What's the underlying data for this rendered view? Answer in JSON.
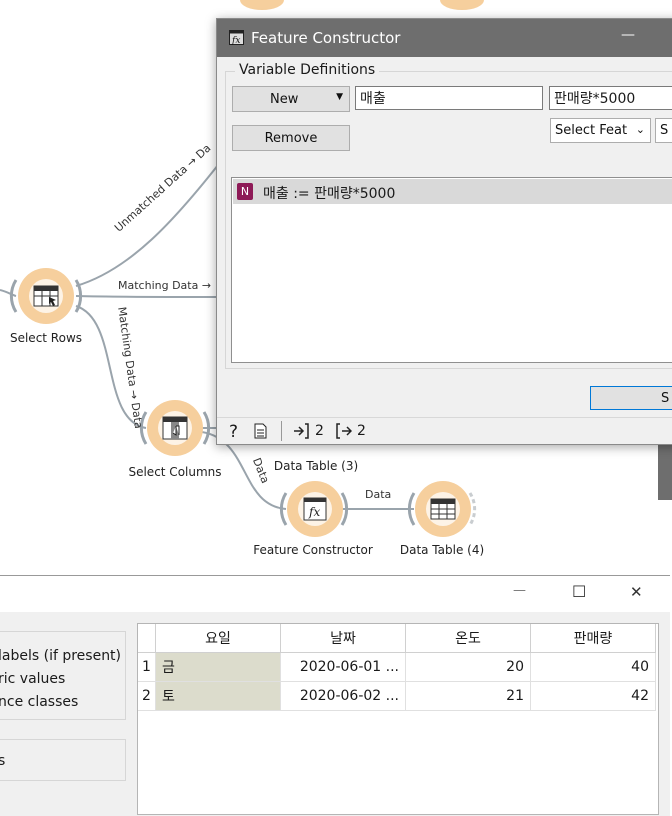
{
  "canvas": {
    "widgets": {
      "select_rows": "Select Rows",
      "select_columns": "Select Columns",
      "data_table_3": "Data Table (3)",
      "feature_constructor": "Feature Constructor",
      "data_table_4": "Data Table (4)"
    },
    "links": {
      "unmatched": "Unmatched Data → Da",
      "matching": "Matching Data →",
      "matching_vertical": "Matching Data → Data",
      "data_to_fc": "Data",
      "fc_to_dt": "Data"
    }
  },
  "feature_constructor": {
    "title": "Feature Constructor",
    "minimize": "—",
    "group_title": "Variable Definitions",
    "new_button": "New",
    "remove_button": "Remove",
    "name_value": "매출",
    "expression_value": "판매량*5000",
    "select_feature": "Select Feat",
    "select_function": "S",
    "variables": [
      {
        "badge": "N",
        "text": "매출 := 판매량*5000"
      }
    ],
    "send_button": "S",
    "status_in": "2",
    "status_out": "2"
  },
  "data_table": {
    "title_controls": {
      "minimize": "—",
      "maximize": "☐",
      "close": "✕"
    },
    "options": [
      "labels (if present)",
      "ric values",
      "nce classes"
    ],
    "option_extra": "s",
    "columns": [
      "요일",
      "날짜",
      "온도",
      "판매량"
    ],
    "rows": [
      {
        "index": "1",
        "cells": [
          "금",
          "2020-06-01 ...",
          "20",
          "40"
        ]
      },
      {
        "index": "2",
        "cells": [
          "토",
          "2020-06-02 ...",
          "21",
          "42"
        ]
      }
    ]
  },
  "colors": {
    "widget_orange": "#f6cf9d",
    "title_bar": "#6e6e6e",
    "selected_row": "#d9d9d9",
    "badge_purple": "#8e1a57",
    "meta_cell": "#dcdccc"
  }
}
